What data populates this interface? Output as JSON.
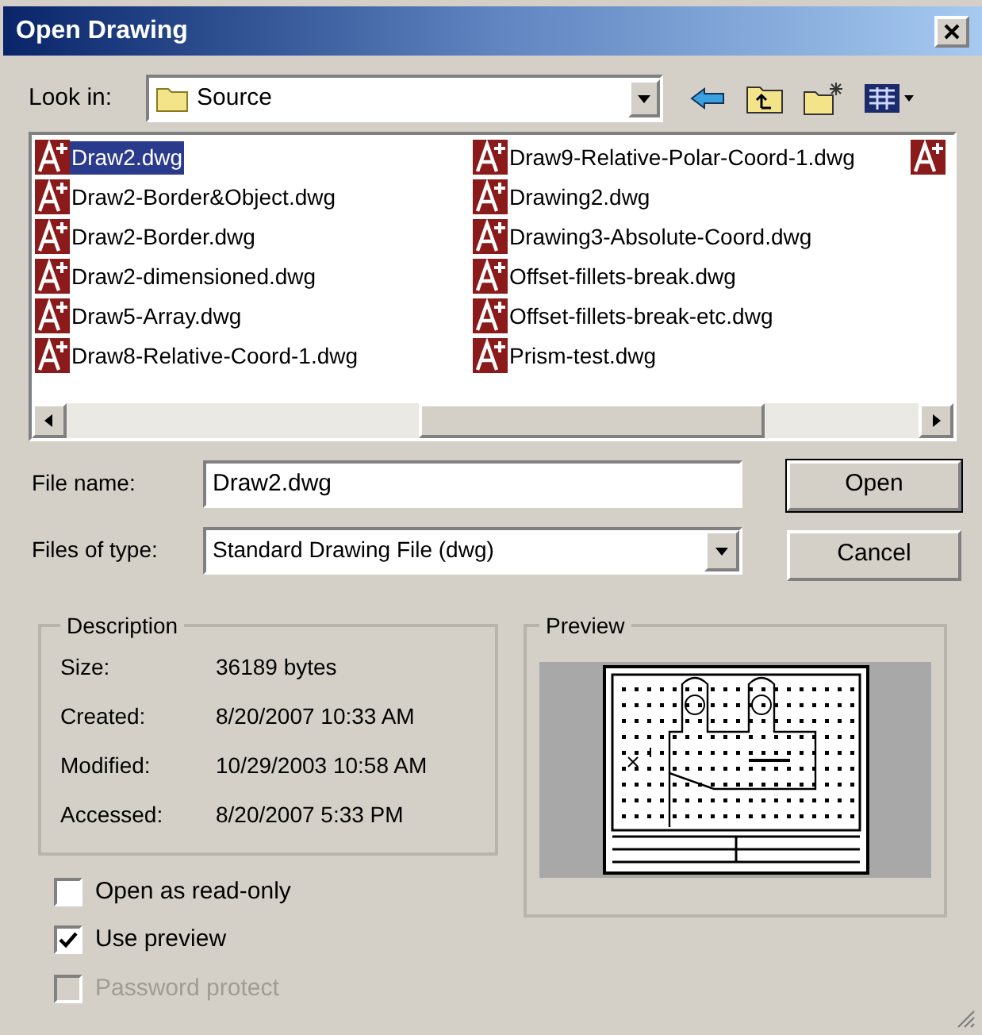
{
  "window": {
    "title": "Open Drawing"
  },
  "look_in": {
    "label": "Look in:",
    "value": "Source"
  },
  "files": [
    {
      "name": "Draw2.dwg",
      "selected": true
    },
    {
      "name": "Draw2-Border&Object.dwg",
      "selected": false
    },
    {
      "name": "Draw2-Border.dwg",
      "selected": false
    },
    {
      "name": "Draw2-dimensioned.dwg",
      "selected": false
    },
    {
      "name": "Draw5-Array.dwg",
      "selected": false
    },
    {
      "name": "Draw8-Relative-Coord-1.dwg",
      "selected": false
    },
    {
      "name": "Draw9-Relative-Polar-Coord-1.dwg",
      "selected": false
    },
    {
      "name": "Drawing2.dwg",
      "selected": false
    },
    {
      "name": "Drawing3-Absolute-Coord.dwg",
      "selected": false
    },
    {
      "name": "Offset-fillets-break.dwg",
      "selected": false
    },
    {
      "name": "Offset-fillets-break-etc.dwg",
      "selected": false
    },
    {
      "name": "Prism-test.dwg",
      "selected": false
    }
  ],
  "file_name": {
    "label": "File name:",
    "value": "Draw2.dwg"
  },
  "file_type": {
    "label": "Files of type:",
    "value": "Standard Drawing File (dwg)"
  },
  "buttons": [
    {
      "label": "Open",
      "default": true
    },
    {
      "label": "Cancel",
      "default": false
    }
  ],
  "description": {
    "title": "Description",
    "rows": [
      {
        "label": "Size:",
        "value": "36189 bytes"
      },
      {
        "label": "Created:",
        "value": "8/20/2007 10:33 AM"
      },
      {
        "label": "Modified:",
        "value": "10/29/2003 10:58 AM"
      },
      {
        "label": "Accessed:",
        "value": "8/20/2007 5:33 PM"
      }
    ]
  },
  "preview": {
    "title": "Preview"
  },
  "options": [
    {
      "label": "Open as read-only",
      "checked": false,
      "disabled": false
    },
    {
      "label": "Use preview",
      "checked": true,
      "disabled": false
    },
    {
      "label": "Password protect",
      "checked": false,
      "disabled": true
    }
  ]
}
